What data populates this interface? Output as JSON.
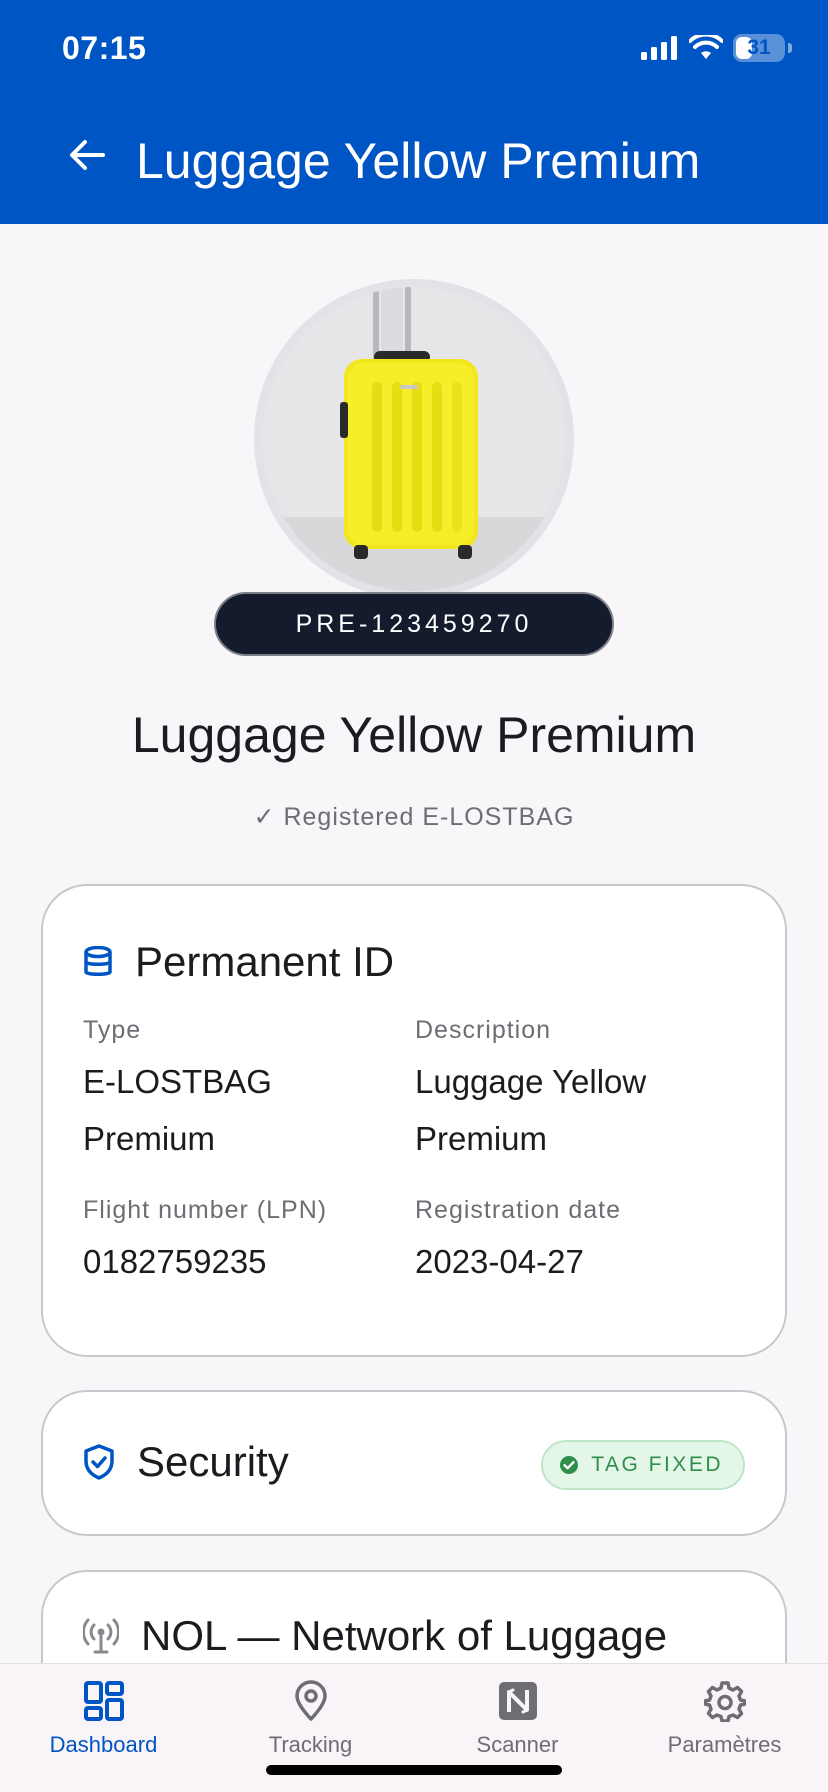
{
  "status_bar": {
    "time": "07:15",
    "battery": "31"
  },
  "header": {
    "title": "Luggage Yellow Premium"
  },
  "item": {
    "id_code": "PRE-123459270",
    "title": "Luggage Yellow Premium",
    "status": "✓ Registered E-LOSTBAG"
  },
  "permanent": {
    "title": "Permanent ID",
    "fields": [
      {
        "label": "Type",
        "value": "E-LOSTBAG Premium"
      },
      {
        "label": "Description",
        "value": "Luggage Yellow Premium"
      },
      {
        "label": "Flight number (LPN)",
        "value": "0182759235"
      },
      {
        "label": "Registration date",
        "value": "2023-04-27"
      }
    ]
  },
  "security": {
    "title": "Security",
    "badge": "TAG FIXED"
  },
  "nol": {
    "title": "NOL — Network of Luggage"
  },
  "nav": {
    "items": [
      {
        "label": "Dashboard",
        "icon": "dashboard-icon"
      },
      {
        "label": "Tracking",
        "icon": "map-pin-icon"
      },
      {
        "label": "Scanner",
        "icon": "nfc-icon"
      },
      {
        "label": "Paramètres",
        "icon": "gear-icon"
      }
    ]
  },
  "colors": {
    "primary": "#0055c4",
    "pill_bg": "#141b2d",
    "badge_bg": "#e3f6e7",
    "badge_text": "#2e8f4a"
  }
}
